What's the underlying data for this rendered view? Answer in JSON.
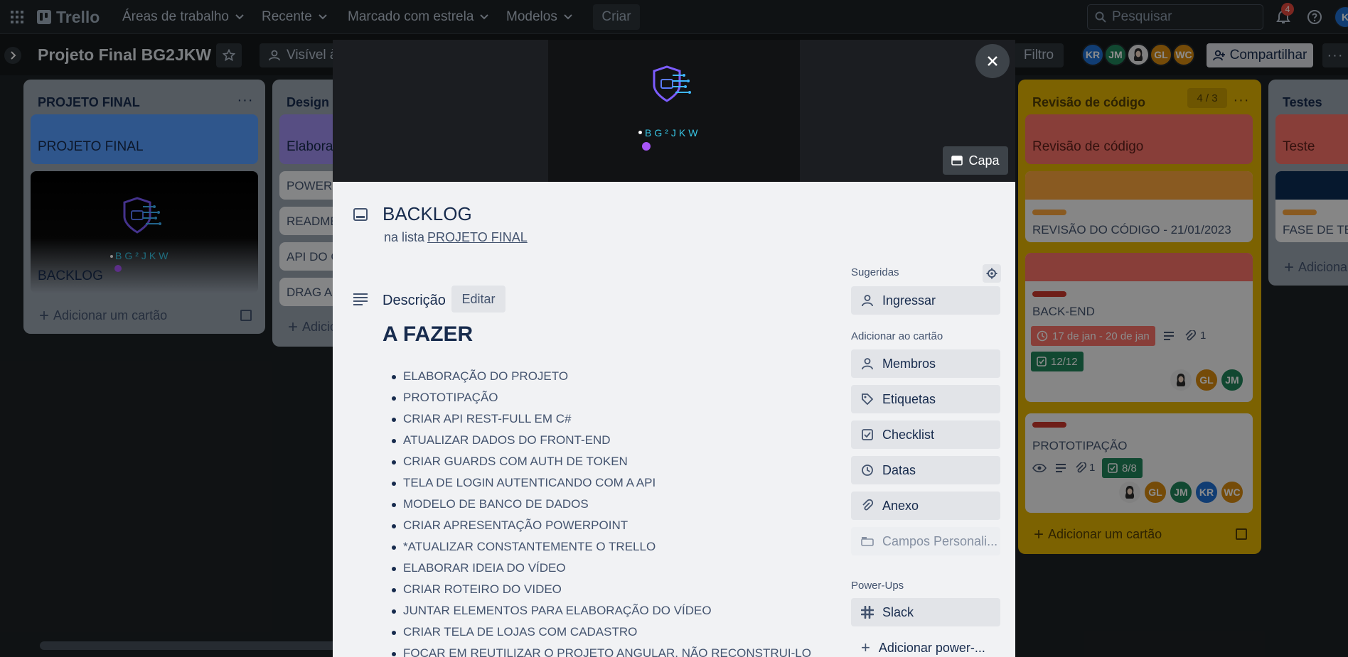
{
  "header": {
    "logo": "Trello",
    "workspaces": "Áreas de trabalho",
    "recent": "Recente",
    "starred": "Marcado com estrela",
    "templates": "Modelos",
    "create": "Criar",
    "search_placeholder": "Pesquisar",
    "notifications_count": "4"
  },
  "board": {
    "title": "Projeto Final BG2JKW",
    "visibility": "Visível à",
    "filter": "Filtro",
    "share": "Compartilhar",
    "members": [
      {
        "initials": "KR",
        "color": "#1f6fd1"
      },
      {
        "initials": "JM",
        "color": "#1f845a"
      },
      {
        "initials": "",
        "color": "#e9e9e9"
      },
      {
        "initials": "GL",
        "color": "#d68910"
      },
      {
        "initials": "WC",
        "color": "#d68910"
      }
    ],
    "partial_avatar": "K"
  },
  "lists": {
    "projeto": {
      "title": "PROJETO FINAL",
      "cards": [
        "PROJETO FINAL",
        "BACKLOG"
      ],
      "cover_logo": "BG²JKW",
      "add": "Adicionar um cartão"
    },
    "design": {
      "title": "Design",
      "cards": [
        "Elabora",
        "POWERP",
        "README",
        "API DO C",
        "DRAG AN"
      ],
      "add": "Adicio"
    },
    "revisao": {
      "title": "Revisão de código",
      "count": "4 / 3",
      "card_cover": "Revisão de código",
      "card2": "REVISÃO DO CÓDIGO - 21/01/2023",
      "card3_title": "BACK-END",
      "card3_dates": "17 de jan - 20 de jan",
      "card3_attach": "1",
      "card3_check": "12/12",
      "card3_members": [
        "",
        "GL",
        "JM"
      ],
      "card4_title": "PROTOTIPAÇÃO",
      "card4_attach": "1",
      "card4_check": "8/8",
      "card4_members": [
        "",
        "GL",
        "JM",
        "KR",
        "WC"
      ],
      "add": "Adicionar um cartão"
    },
    "testes": {
      "title": "Testes",
      "card_cover": "Teste",
      "card2": "FASE DE TES",
      "add": "Adiciona"
    }
  },
  "modal": {
    "cover_logo": "BG²JKW",
    "cover_button": "Capa",
    "title": "BACKLOG",
    "in_list_prefix": "na lista",
    "list_name": "PROJETO FINAL",
    "description_label": "Descrição",
    "edit": "Editar",
    "todo_heading": "A FAZER",
    "todo_items": [
      "ELABORAÇÃO DO PROJETO",
      "PROTOTIPAÇÃO",
      "CRIAR API REST-FULL EM C#",
      "ATUALIZAR DADOS DO FRONT-END",
      "CRIAR GUARDS COM AUTH DE TOKEN",
      "TELA DE LOGIN AUTENTICANDO COM A API",
      "MODELO DE BANCO DE DADOS",
      "CRIAR APRESENTAÇÃO POWERPOINT",
      "*ATUALIZAR CONSTANTEMENTE O TRELLO",
      "ELABORAR IDEIA DO VÍDEO",
      "CRIAR ROTEIRO DO VIDEO",
      "JUNTAR ELEMENTOS PARA ELABORAÇÃO DO VÍDEO",
      "CRIAR TELA DE LOJAS COM CADASTRO",
      "FOCAR EM REUTILIZAR O PROJETO ANGULAR, NÃO RECONSTRUI-LO"
    ],
    "sidebar": {
      "suggested": "Sugeridas",
      "join": "Ingressar",
      "add_to_card": "Adicionar ao cartão",
      "members": "Membros",
      "labels": "Etiquetas",
      "checklist": "Checklist",
      "dates": "Datas",
      "attachment": "Anexo",
      "custom_fields": "Campos Personali...",
      "powerups": "Power-Ups",
      "slack": "Slack",
      "add_powerup": "Adicionar power-..."
    }
  }
}
